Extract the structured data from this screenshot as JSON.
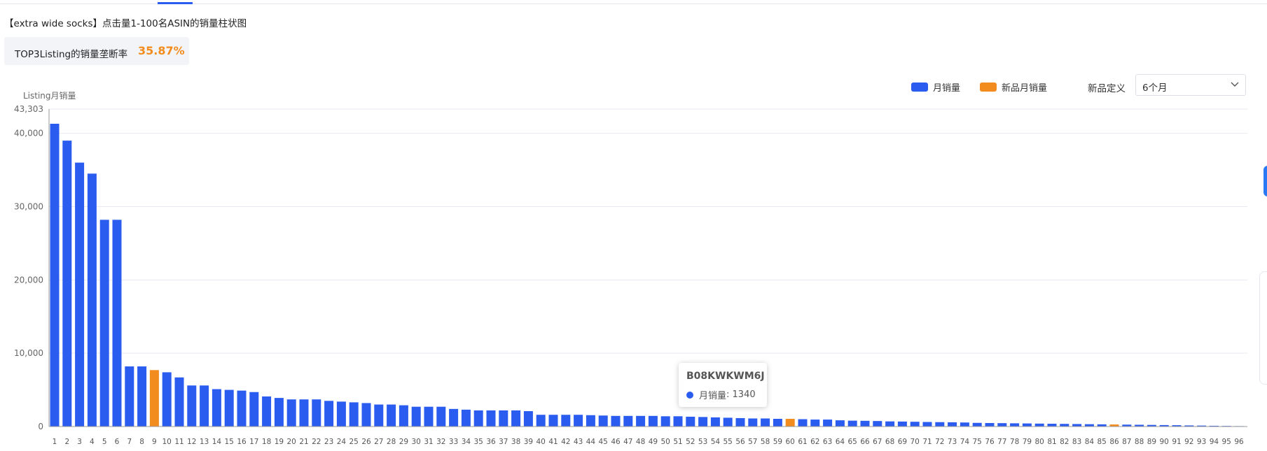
{
  "header": {
    "title": "【extra wide socks】点击量1-100名ASIN的销量柱状图"
  },
  "kpi": {
    "label": "TOP3Listing的销量垄断率",
    "value": "35.87%"
  },
  "legend": {
    "monthly_sales": "月销量",
    "new_product_sales": "新品月销量"
  },
  "new_product_definition": {
    "label": "新品定义",
    "selected": "6个月"
  },
  "tooltip": {
    "asin": "B08KWKWM6J",
    "series": "月销量",
    "value_text": "1340"
  },
  "colors": {
    "monthly": "#2b5cf0",
    "new_product": "#f28c1e",
    "accent": "#f28c1e"
  },
  "chart_data": {
    "type": "bar",
    "ylabel": "Listing月销量",
    "ylim": [
      0,
      43303
    ],
    "y_ticks": [
      0,
      10000,
      20000,
      30000,
      40000,
      43303
    ],
    "y_tick_labels": [
      "0",
      "10,000",
      "20,000",
      "30,000",
      "40,000",
      "43,303"
    ],
    "grid": true,
    "legend_position": "top-right",
    "categories": [
      1,
      2,
      3,
      4,
      5,
      6,
      7,
      8,
      9,
      10,
      11,
      12,
      13,
      14,
      15,
      16,
      17,
      18,
      19,
      20,
      21,
      22,
      23,
      24,
      25,
      26,
      27,
      28,
      29,
      30,
      31,
      32,
      33,
      34,
      35,
      36,
      37,
      38,
      39,
      40,
      41,
      42,
      43,
      44,
      45,
      46,
      47,
      48,
      49,
      50,
      51,
      52,
      53,
      54,
      55,
      56,
      57,
      58,
      59,
      60,
      61,
      62,
      63,
      64,
      65,
      66,
      67,
      68,
      69,
      70,
      71,
      72,
      73,
      74,
      75,
      76,
      77,
      78,
      79,
      80,
      81,
      82,
      83,
      84,
      85,
      86,
      87,
      88,
      89,
      90,
      91,
      92,
      93,
      94,
      95,
      96
    ],
    "values": [
      41300,
      39000,
      36000,
      34500,
      28200,
      28200,
      8200,
      8200,
      7700,
      7400,
      6700,
      5600,
      5600,
      5100,
      5000,
      4900,
      4700,
      4100,
      3900,
      3700,
      3700,
      3700,
      3500,
      3400,
      3300,
      3200,
      3000,
      3000,
      2900,
      2700,
      2700,
      2700,
      2400,
      2300,
      2200,
      2200,
      2200,
      2200,
      2100,
      1600,
      1600,
      1600,
      1600,
      1550,
      1500,
      1450,
      1450,
      1450,
      1450,
      1400,
      1400,
      1340,
      1300,
      1250,
      1200,
      1150,
      1100,
      1100,
      1050,
      1050,
      1000,
      950,
      950,
      850,
      800,
      780,
      750,
      700,
      680,
      650,
      620,
      600,
      580,
      550,
      500,
      480,
      460,
      440,
      420,
      400,
      380,
      360,
      340,
      320,
      300,
      280,
      260,
      240,
      220,
      200,
      180,
      150,
      130,
      100,
      80,
      60
    ],
    "new_product_indices": [
      9,
      60,
      86
    ]
  }
}
